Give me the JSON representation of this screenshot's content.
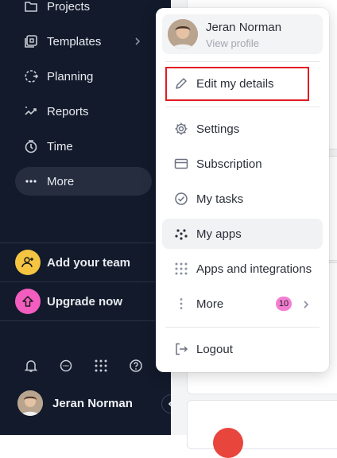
{
  "sidebar": {
    "items": [
      {
        "label": "Projects",
        "icon": "folder-icon"
      },
      {
        "label": "Templates",
        "icon": "templates-icon"
      },
      {
        "label": "Planning",
        "icon": "planning-icon"
      },
      {
        "label": "Reports",
        "icon": "reports-icon"
      },
      {
        "label": "Time",
        "icon": "timer-icon"
      },
      {
        "label": "More",
        "icon": "more-dots-icon"
      }
    ],
    "add_team_label": "Add your team",
    "upgrade_label": "Upgrade now",
    "user_name": "Jeran Norman"
  },
  "menu": {
    "profile_name": "Jeran Norman",
    "profile_sub": "View profile",
    "edit_details": "Edit my details",
    "settings": "Settings",
    "subscription": "Subscription",
    "my_tasks": "My tasks",
    "my_apps": "My apps",
    "apps_integrations": "Apps and integrations",
    "more": "More",
    "more_count": "10",
    "logout": "Logout"
  },
  "colors": {
    "sidebar_bg": "#121a2b",
    "add_team_accent": "#f5c542",
    "upgrade_accent": "#f25dbf",
    "badge": "#f47ed2",
    "highlight": "#e31b23"
  }
}
